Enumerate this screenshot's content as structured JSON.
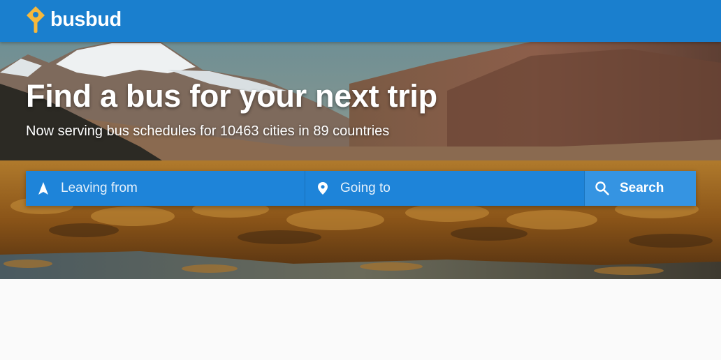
{
  "header": {
    "brand": "busbud",
    "logo_icon": "busbud-pin-logo-icon",
    "background_color": "#1a7fce",
    "logo_color": "#f6b83c"
  },
  "hero": {
    "title": "Find a bus for your next trip",
    "subtitle": "Now serving bus schedules for 10463 cities in 89 countries"
  },
  "search": {
    "from_placeholder": "Leaving from",
    "from_icon": "navigation-arrow-icon",
    "to_placeholder": "Going to",
    "to_icon": "map-pin-icon",
    "button_label": "Search",
    "button_icon": "magnifier-icon",
    "field_color": "#1e84d9",
    "button_color": "#3594e2"
  },
  "page": {
    "background_color": "#fafafa"
  }
}
